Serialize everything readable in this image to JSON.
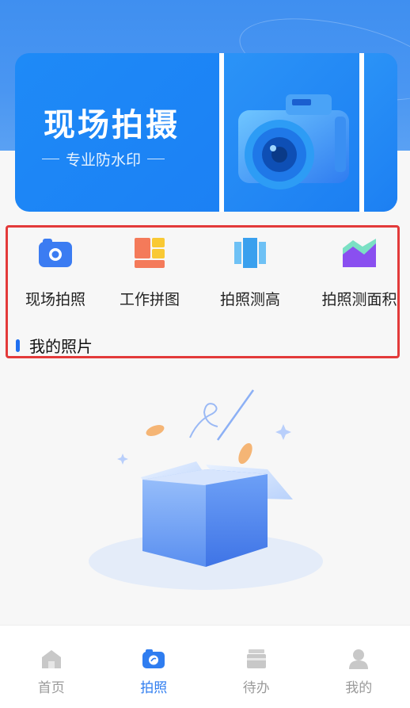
{
  "banner": {
    "title": "现场拍摄",
    "subtitle": "专业防水印"
  },
  "features": [
    {
      "label": "现场拍照",
      "icon": "camera-icon",
      "color": "#3b7cf2"
    },
    {
      "label": "工作拼图",
      "icon": "collage-icon",
      "color": "#f47a5a"
    },
    {
      "label": "拍照测高",
      "icon": "measure-height-icon",
      "color": "#3aa0ee"
    },
    {
      "label": "拍照测面积",
      "icon": "area-chart-icon",
      "color": "#8a4ff0"
    }
  ],
  "section": {
    "title": "我的照片"
  },
  "tabbar": {
    "items": [
      {
        "label": "首页",
        "icon": "home-icon",
        "active": false
      },
      {
        "label": "拍照",
        "icon": "camera-tab-icon",
        "active": true
      },
      {
        "label": "待办",
        "icon": "todo-icon",
        "active": false
      },
      {
        "label": "我的",
        "icon": "profile-icon",
        "active": false
      }
    ]
  },
  "colors": {
    "accent": "#2f7df0",
    "highlight_border": "#e33a3a"
  }
}
